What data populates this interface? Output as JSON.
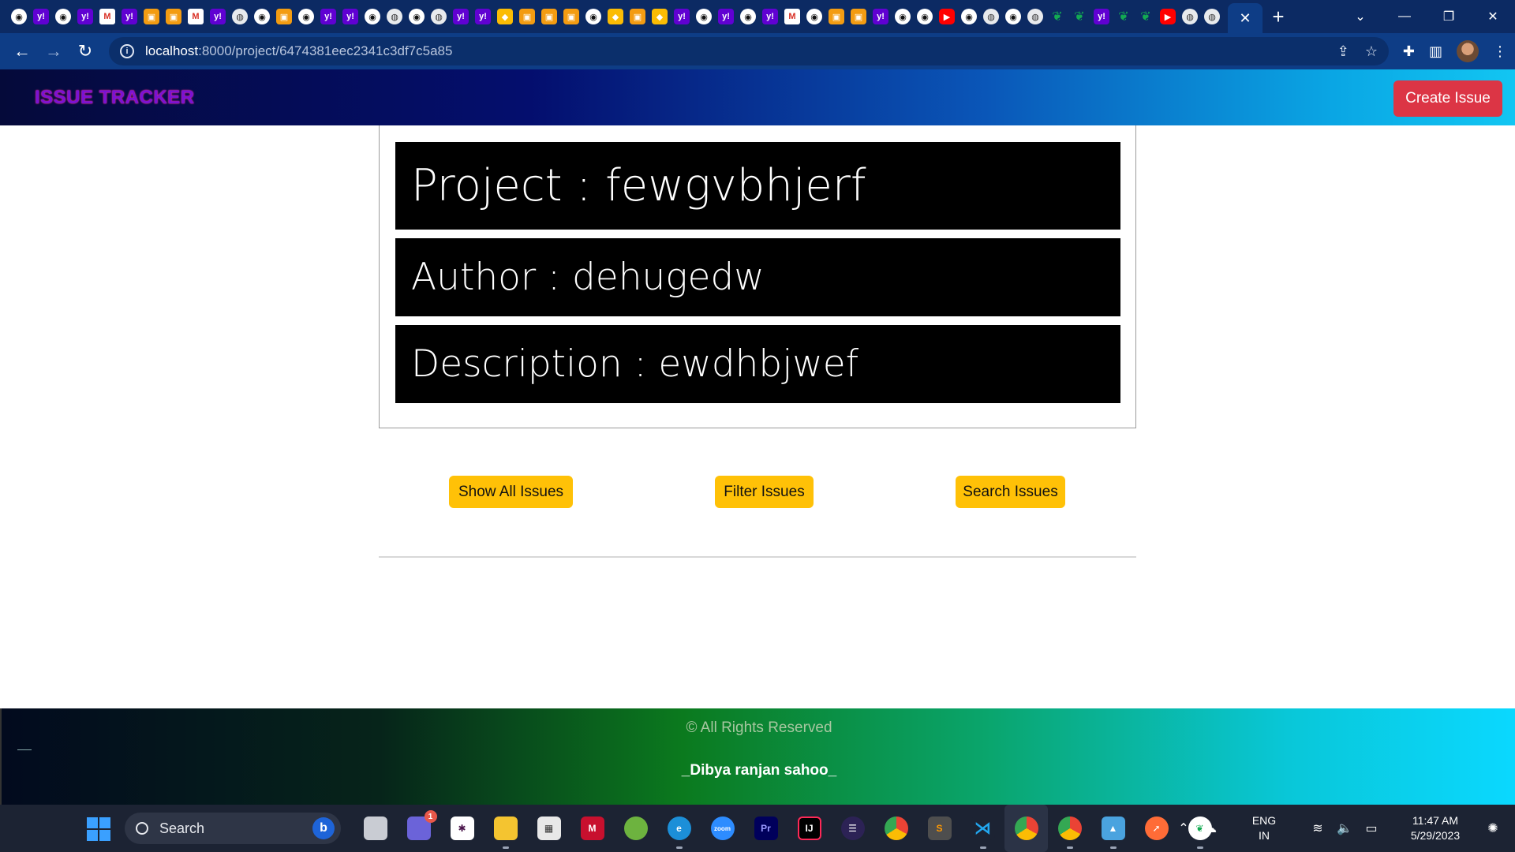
{
  "browser": {
    "tab_favicons": [
      "github",
      "yahoo",
      "github",
      "yahoo",
      "gmail",
      "yahoo",
      "cn",
      "cn",
      "gmail",
      "yahoo",
      "globe",
      "github",
      "cn",
      "github",
      "yahoo",
      "yahoo",
      "github",
      "globe",
      "github",
      "globe",
      "yahoo",
      "yahoo",
      "other",
      "cn",
      "cn",
      "cn",
      "github",
      "other",
      "cn",
      "other",
      "yahoo",
      "github",
      "yahoo",
      "github",
      "yahoo",
      "gmail",
      "github",
      "cn",
      "cn",
      "yahoo",
      "github",
      "github",
      "yt",
      "github",
      "globe",
      "github",
      "globe",
      "mongo",
      "mongo",
      "yahoo",
      "mongo",
      "mongo",
      "yt",
      "globe",
      "globe"
    ],
    "active_tab_close": "✕",
    "new_tab": "+",
    "url_host": "localhost",
    "url_path": ":8000/project/6474381eec2341c3df7c5a85"
  },
  "navbar": {
    "brand": "ISSUE TRACKER",
    "create_issue": "Create Issue"
  },
  "project": {
    "title": "Project : fewgvbhjerf",
    "author": "Author : dehugedw",
    "description": "Description : ewdhbjwef"
  },
  "actions": {
    "show_all": "Show All Issues",
    "filter": "Filter Issues",
    "search": "Search Issues"
  },
  "footer": {
    "copyright": "© All Rights Reserved",
    "author": "_Dibya ranjan sahoo_"
  },
  "taskbar": {
    "search_label": "Search",
    "notification_badge": "1",
    "lang_top": "ENG",
    "lang_bottom": "IN",
    "time": "11:47 AM",
    "date": "5/29/2023"
  }
}
